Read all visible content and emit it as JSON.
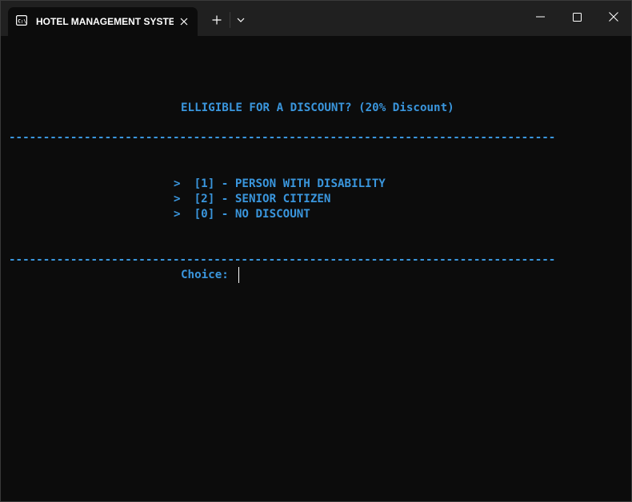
{
  "window": {
    "tab_title": "HOTEL MANAGEMENT SYSTEI",
    "tab_icon": "terminal-icon",
    "controls": [
      "minimize-icon",
      "maximize-icon",
      "close-icon"
    ]
  },
  "terminal": {
    "heading": "ELLIGIBLE FOR A DISCOUNT? (20% Discount)",
    "rule": "--------------------------------------------------------------------------------",
    "options": [
      ">  [1] - PERSON WITH DISABILITY",
      ">  [2] - SENIOR CITIZEN",
      ">  [0] - NO DISCOUNT"
    ],
    "prompt": "Choice:"
  },
  "colors": {
    "terminal_bg": "#0c0c0c",
    "text": "#3a96dd",
    "titlebar": "#202020"
  }
}
